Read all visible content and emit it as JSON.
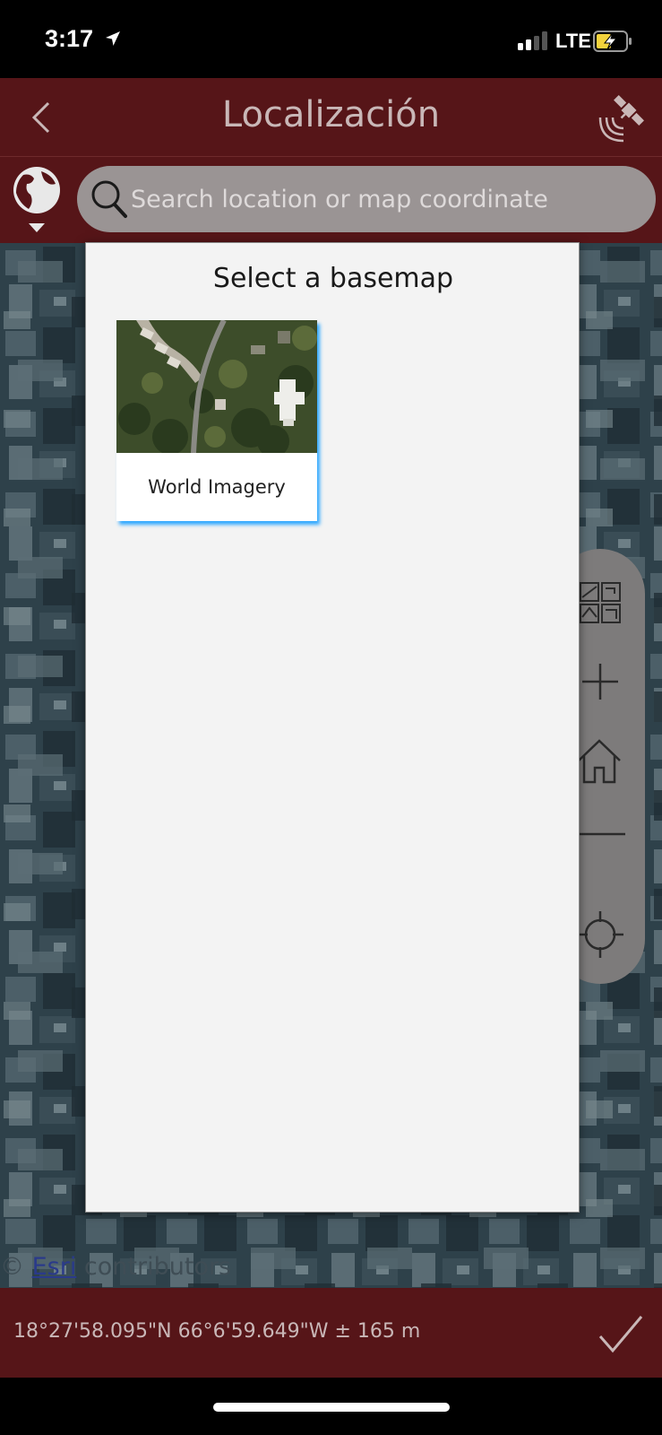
{
  "status": {
    "time": "3:17",
    "network": "LTE",
    "icons": [
      "location-arrow-icon",
      "signal-icon",
      "battery-charging-icon"
    ]
  },
  "header": {
    "title": "Localización",
    "icons": [
      "chevron-left-icon",
      "satellite-gps-icon"
    ]
  },
  "search": {
    "placeholder": "Search location or map coordinate",
    "icons": [
      "globe-icon",
      "search-icon"
    ]
  },
  "modal": {
    "title": "Select a basemap",
    "basemaps": [
      {
        "label": "World Imagery",
        "selected": true
      }
    ]
  },
  "map": {
    "attribution_prefix": "©",
    "attribution_link": "Esri",
    "attribution_suffix": "contributors",
    "tools": [
      "basemap-gallery-icon",
      "zoom-in-icon",
      "home-icon",
      "zoom-out-icon",
      "locate-icon"
    ]
  },
  "footer": {
    "coordinates": "18°27'58.095\"N 66°6'59.649\"W ± 165 m",
    "confirm_icon": "checkmark-icon"
  },
  "colors": {
    "header_bg": "#561518",
    "header_text": "#c9b7b7",
    "selection_glow": "#2fa8ff",
    "modal_bg": "#f3f3f3"
  }
}
